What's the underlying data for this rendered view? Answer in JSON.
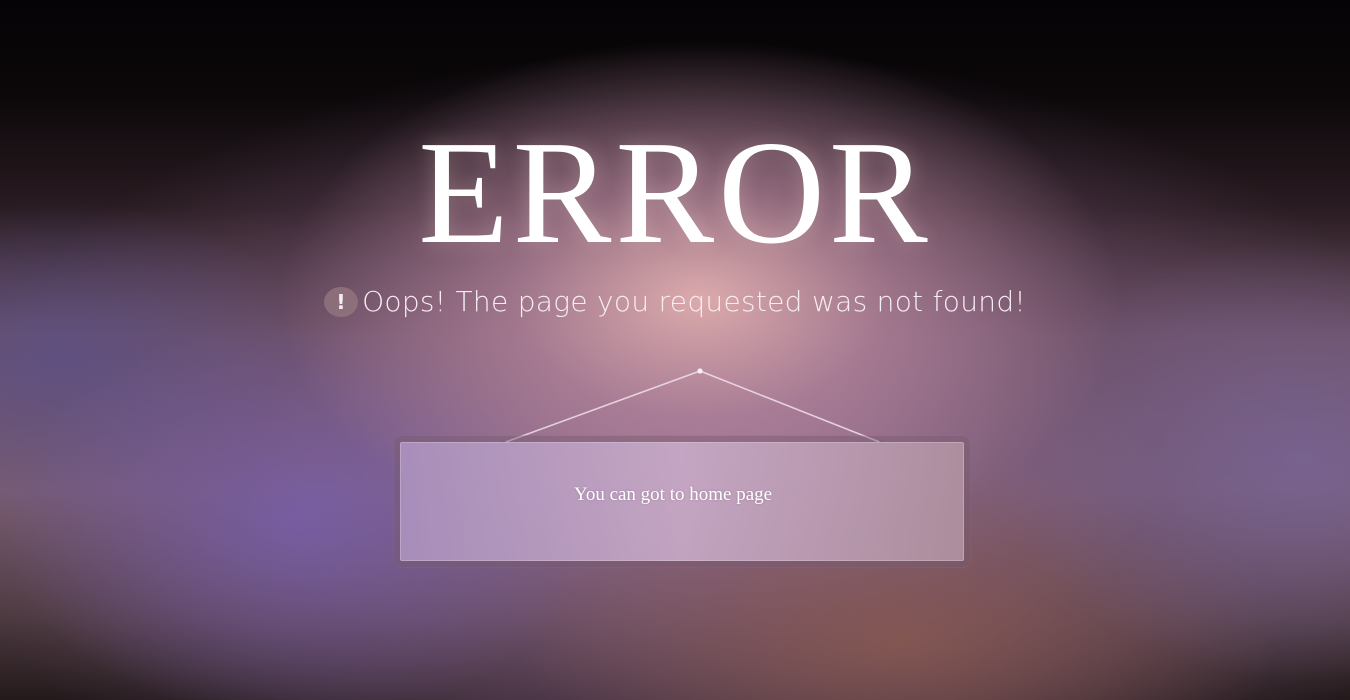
{
  "page": {
    "title": "ERROR",
    "message": "Oops! The page you requested was not found!",
    "alert_icon": "!",
    "home_link_label": "You can got to home page"
  },
  "icons": {
    "alert": "alert-circle-icon"
  },
  "colors": {
    "title": "#ffffff",
    "message": "#f7eef2",
    "sign_panel": "#c4a8c8",
    "wire": "#f0e0ea"
  }
}
